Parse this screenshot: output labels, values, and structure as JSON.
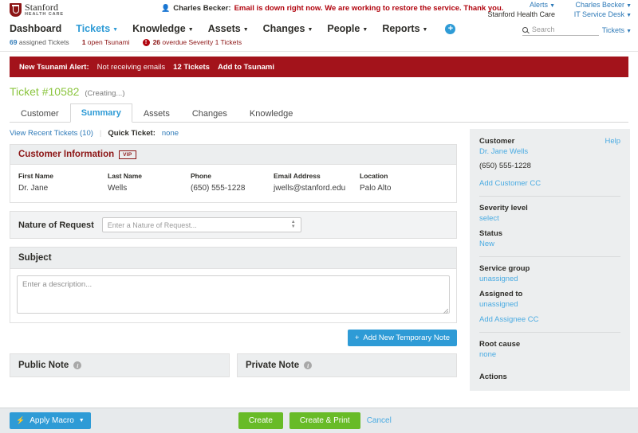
{
  "topbar": {
    "logo_name": "Stanford",
    "logo_sub": "HEALTH CARE",
    "person_icon": "person-icon",
    "alert_user": "Charles Becker:",
    "alert_message": "Email is down right now. We are working to restore the service. Thank you.",
    "alerts_label": "Alerts",
    "user_label": "Charles Becker",
    "org_label": "Stanford Health Care",
    "desk_label": "IT Service Desk",
    "search_placeholder": "Search",
    "search_value": "",
    "search_scope": "Tickets"
  },
  "nav": {
    "items": [
      {
        "label": "Dashboard",
        "caret": false,
        "active": false
      },
      {
        "label": "Tickets",
        "caret": true,
        "active": true
      },
      {
        "label": "Knowledge",
        "caret": true,
        "active": false
      },
      {
        "label": "Assets",
        "caret": true,
        "active": false
      },
      {
        "label": "Changes",
        "caret": true,
        "active": false
      },
      {
        "label": "People",
        "caret": true,
        "active": false
      },
      {
        "label": "Reports",
        "caret": true,
        "active": false
      }
    ],
    "add_icon": "plus-icon"
  },
  "subnav": {
    "assigned_count": "69",
    "assigned_label": "assigned Tickets",
    "tsunami_count": "1",
    "tsunami_label": "open Tsunami",
    "overdue_icon": "exclamation-icon",
    "overdue_count": "26",
    "overdue_label": "overdue Severity 1 Tickets"
  },
  "banner": {
    "title": "New Tsunami Alert:",
    "subject": "Not receiving emails",
    "count": "12 Tickets",
    "action": "Add to Tsunami"
  },
  "ticket": {
    "title": "Ticket #10582",
    "state": "(Creating...)",
    "tabs": [
      {
        "label": "Customer",
        "active": false
      },
      {
        "label": "Summary",
        "active": true
      },
      {
        "label": "Assets",
        "active": false
      },
      {
        "label": "Changes",
        "active": false
      },
      {
        "label": "Knowledge",
        "active": false
      }
    ]
  },
  "quickrow": {
    "recent_tickets": "View Recent Tickets (10)",
    "quick_ticket_label": "Quick Ticket:",
    "quick_ticket_value": "none"
  },
  "customer_card": {
    "title": "Customer Information",
    "badge": "VIP",
    "fields": [
      {
        "label": "First Name",
        "value": "Dr. Jane"
      },
      {
        "label": "Last Name",
        "value": "Wells"
      },
      {
        "label": "Phone",
        "value": "(650) 555-1228"
      },
      {
        "label": "Email Address",
        "value": "jwells@stanford.edu"
      },
      {
        "label": "Location",
        "value": "Palo Alto"
      }
    ]
  },
  "nature_of_request": {
    "label": "Nature of Request",
    "placeholder": "Enter a Nature of Request...",
    "value": ""
  },
  "subject": {
    "title": "Subject",
    "placeholder": "Enter a description...",
    "value": ""
  },
  "temp_note_button": {
    "icon": "plus-icon",
    "label": "Add New Temporary Note"
  },
  "notes": {
    "public_label": "Public Note",
    "private_label": "Private Note",
    "info_icon": "info-icon"
  },
  "sidebar": {
    "help_label": "Help",
    "customer_label": "Customer",
    "customer_name": "Dr. Jane Wells",
    "customer_phone": "(650) 555-1228",
    "add_customer_cc": "Add Customer CC",
    "severity_label": "Severity level",
    "severity_value": "select",
    "status_label": "Status",
    "status_value": "New",
    "service_group_label": "Service group",
    "service_group_value": "unassigned",
    "assigned_to_label": "Assigned to",
    "assigned_to_value": "unassigned",
    "add_assignee_cc": "Add Assignee CC",
    "root_cause_label": "Root cause",
    "root_cause_value": "none",
    "actions_label": "Actions"
  },
  "bottombar": {
    "macro_icon": "bolt-icon",
    "macro_label": "Apply Macro",
    "create_label": "Create",
    "create_print_label": "Create & Print",
    "cancel_label": "Cancel"
  },
  "colors": {
    "brand_red": "#8c1515",
    "banner_red": "#a3131b",
    "link_blue": "#2e7ab8",
    "accent_blue": "#2e9bd6",
    "green": "#68bb27",
    "title_green": "#8bc53f"
  }
}
